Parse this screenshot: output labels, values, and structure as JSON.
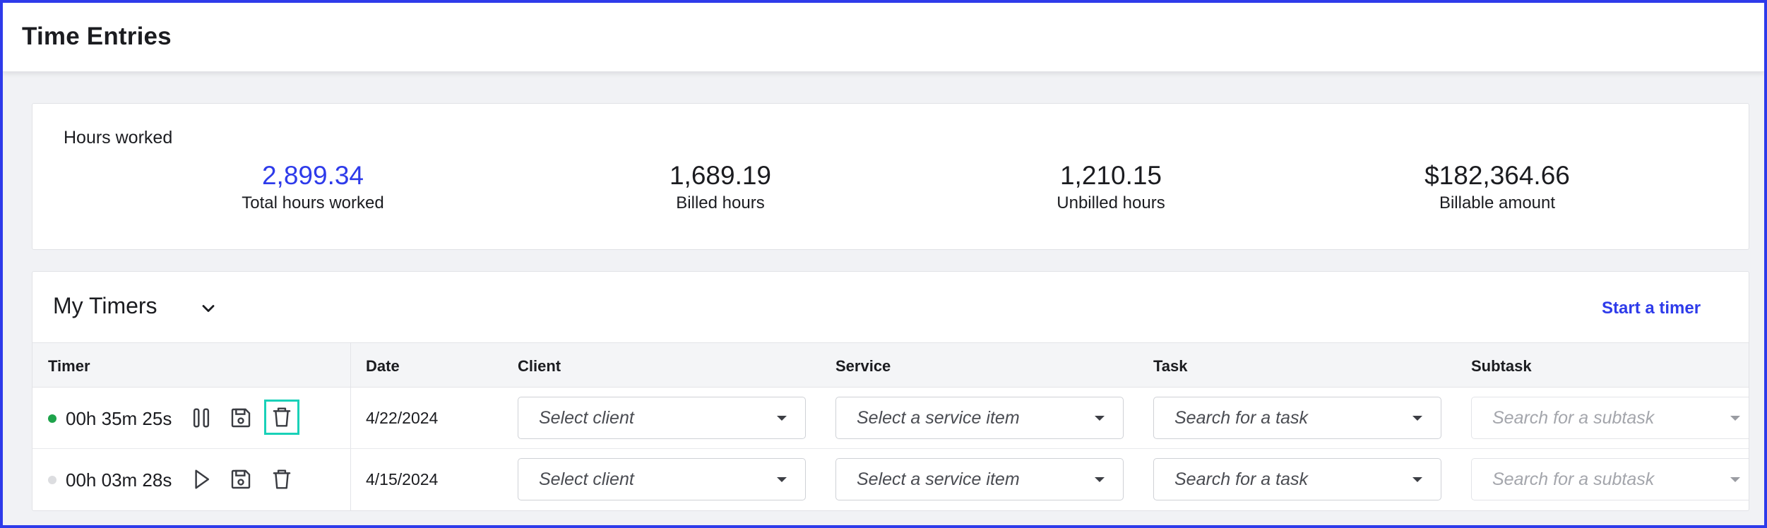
{
  "header": {
    "title": "Time Entries"
  },
  "hours": {
    "title": "Hours worked",
    "stats": [
      {
        "value": "2,899.34",
        "label": "Total hours worked"
      },
      {
        "value": "1,689.19",
        "label": "Billed hours"
      },
      {
        "value": "1,210.15",
        "label": "Unbilled hours"
      },
      {
        "value": "$182,364.66",
        "label": "Billable amount"
      }
    ]
  },
  "timers": {
    "title": "My Timers",
    "start_label": "Start a timer",
    "columns": [
      "Timer",
      "Date",
      "Client",
      "Service",
      "Task",
      "Subtask"
    ],
    "rows": [
      {
        "status": "running",
        "time": "00h 35m 25s",
        "date": "4/22/2024",
        "client_placeholder": "Select client",
        "service_placeholder": "Select a service item",
        "task_placeholder": "Search for a task",
        "subtask_placeholder": "Search for a subtask"
      },
      {
        "status": "paused",
        "time": "00h 03m 28s",
        "date": "4/15/2024",
        "client_placeholder": "Select client",
        "service_placeholder": "Select a service item",
        "task_placeholder": "Search for a task",
        "subtask_placeholder": "Search for a subtask"
      }
    ]
  },
  "colors": {
    "accent": "#2e3bea",
    "running": "#1ea34b",
    "idle": "#dcdde0",
    "highlight": "#19d1b8"
  },
  "icons": [
    "chevron-down-icon",
    "pause-icon",
    "play-icon",
    "save-icon",
    "trash-icon",
    "caret-down-icon"
  ]
}
